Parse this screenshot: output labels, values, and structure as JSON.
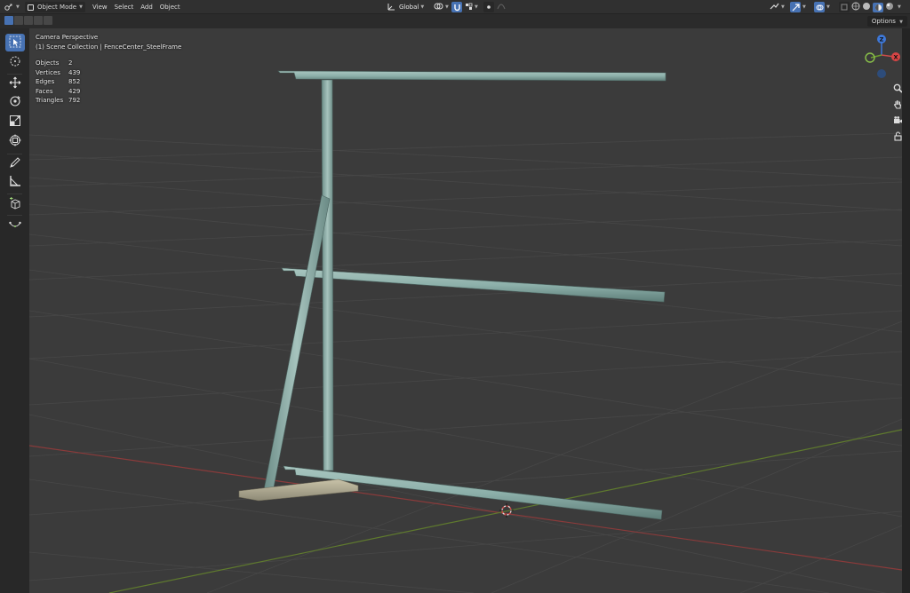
{
  "header": {
    "mode_label": "Object Mode",
    "menus": [
      "View",
      "Select",
      "Add",
      "Object"
    ],
    "transform_orientation": "Global"
  },
  "toolbar_header": {
    "options_label": "Options"
  },
  "viewport": {
    "view_name": "Camera Perspective",
    "collection_line": "(1) Scene Collection | FenceCenter_SteelFrame"
  },
  "stats": [
    {
      "label": "Objects",
      "value": "2"
    },
    {
      "label": "Vertices",
      "value": "439"
    },
    {
      "label": "Edges",
      "value": "852"
    },
    {
      "label": "Faces",
      "value": "429"
    },
    {
      "label": "Triangles",
      "value": "792"
    }
  ],
  "gizmo": {
    "z_label": "Z",
    "x_label": "X"
  },
  "colors": {
    "accent": "#4772b3",
    "x_axis": "#c94b4b",
    "y_axis": "#6d9b2e",
    "z_axis": "#3e78d8",
    "frame_steel": "#8fb3ad"
  },
  "icons": {
    "tools": [
      "select-box-icon",
      "cursor-icon",
      "move-icon",
      "rotate-icon",
      "scale-icon",
      "transform-icon",
      "annotate-icon",
      "measure-icon",
      "add-cube-icon",
      "curve-icon"
    ],
    "nav": [
      "zoom-icon",
      "hand-pan-icon",
      "camera-view-icon",
      "lock-icon"
    ]
  }
}
